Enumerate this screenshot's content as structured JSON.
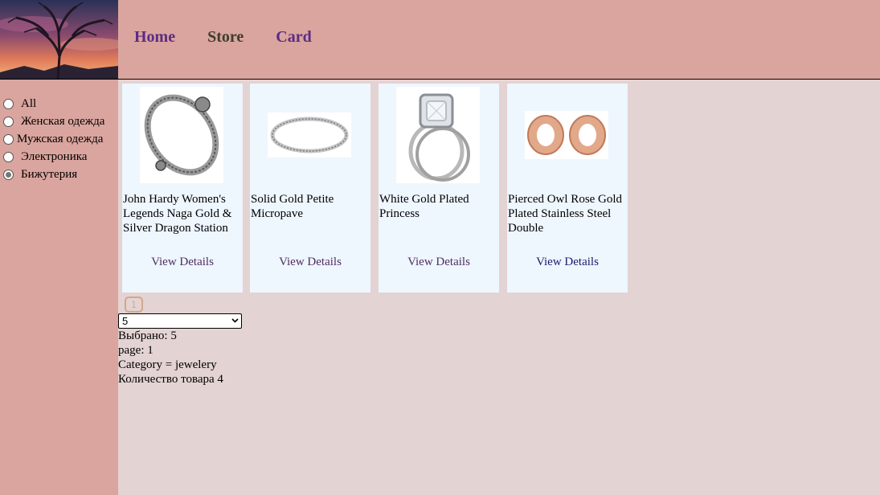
{
  "header": {
    "nav": [
      {
        "label": "Home"
      },
      {
        "label": "Store"
      },
      {
        "label": "Card"
      }
    ]
  },
  "sidebar": {
    "categories": [
      {
        "label": "All",
        "checked": false
      },
      {
        "label": "Женская одежда",
        "checked": false
      },
      {
        "label": "Мужская одежда",
        "checked": false
      },
      {
        "label": "Электроника",
        "checked": false
      },
      {
        "label": "Бижутерия",
        "checked": true
      }
    ]
  },
  "products": [
    {
      "title": "John Hardy Women's Legends Naga Gold & Silver Dragon Station",
      "details_label": "View Details",
      "icon": "bracelet-image"
    },
    {
      "title": "Solid Gold Petite Micropave",
      "details_label": "View Details",
      "icon": "ring-image"
    },
    {
      "title": "White Gold Plated Princess",
      "details_label": "View Details",
      "icon": "engagement-ring-image"
    },
    {
      "title": "Pierced Owl Rose Gold Plated Stainless Steel Double",
      "details_label": "View Details",
      "icon": "plugs-image"
    }
  ],
  "pagination": {
    "current": "1"
  },
  "page_size_select": {
    "value": "5"
  },
  "info": {
    "selected": "Выбрано: 5",
    "page": "page: 1",
    "category": "Category = jewelery",
    "count": "Количество товара 4"
  }
}
